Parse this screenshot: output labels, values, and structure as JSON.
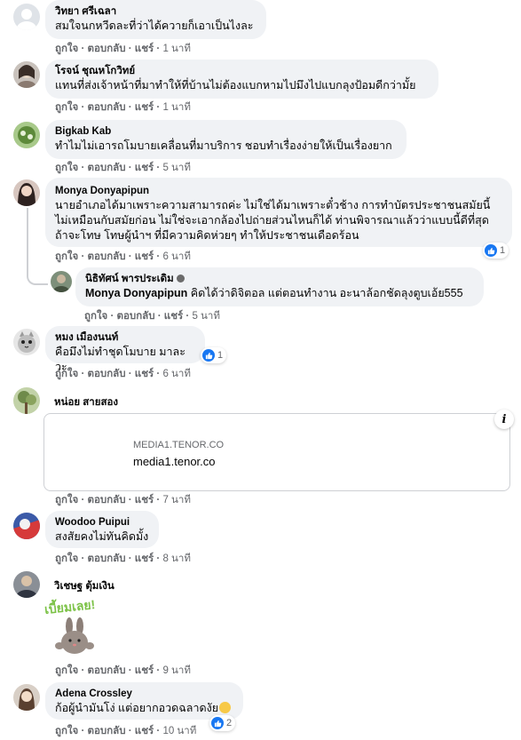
{
  "actions": {
    "like": "ถูกใจ",
    "reply": "ตอบกลับ",
    "share": "แชร์",
    "sep": "·"
  },
  "colors": {
    "bubble": "#f0f2f5",
    "meta": "#65676b",
    "like_blue": "#1877f2"
  },
  "comments": [
    {
      "name": "วิทยา ศรีเฉลา",
      "text": "สมใจนกหวีดละที่ว่าได้ควายก็เอาเป็นไงละ",
      "time": "1 นาที"
    },
    {
      "name": "โรจน์ ชุณหโกวิทย์",
      "text": "แทนที่ส่งเจ้าหน้าที่มาทำให้ที่บ้านไม่ต้องแบกหามไปมึงไปแบกลุงป้อมดีกว่ามั้ย",
      "time": "1 นาที"
    },
    {
      "name": "Bigkab Kab",
      "text": "ทำไมไม่เอารถโมบายเคลื่อนที่มาบริการ ชอบทำเรื่องง่ายให้เป็นเรื่องยาก",
      "time": "5 นาที"
    },
    {
      "name": "Monya Donyapipun",
      "text_lines": [
        "นายอำเภอได้มาเพราะความสามารถค่ะ ไม่ใช่ได้มาเพราะตั๋วช้าง การทำบัตรประชาชนสมัยนี้",
        "ไม่เหมือนกับสมัยก่อน ไม่ใช่จะเอากล้องไปถ่ายส่วนไหนก็ได้ ท่านพิจารณาแล้วว่าแบบนี้ดีที่สุด",
        "ถ้าจะโทษ โทษผู้นำฯ ที่มีความคิดห่วยๆ ทำให้ประชาชนเดือดร้อน"
      ],
      "time": "6 นาที",
      "reaction_count": "1"
    },
    {
      "name": "นิธิทัศน์ พารประเดิม",
      "mention": "Monya Donyapipun",
      "text": " คิดได้ว่าดิจิตอล แต่ตอนทำงาน อะนาล้อกชัดลุงตูบเอ้ย555",
      "time": "5 นาที"
    },
    {
      "name": "หมง เมืองนนท์",
      "text": "คือมึงไม่ทำชุดโมบาย มาละวะ",
      "time": "6 นาที",
      "reaction_count": "1"
    },
    {
      "name": "หน่อย สายสอง",
      "link_domain_caps": "MEDIA1.TENOR.CO",
      "link_domain": "media1.tenor.co",
      "info_icon": "i",
      "time": "7 นาที"
    },
    {
      "name": "Woodoo Puipui",
      "text": "สงสัยคงไม่ทันคิดมั้ง",
      "time": "8 นาที"
    },
    {
      "name": "วิเชษฐ ตุ้มเงิน",
      "sticker_text": "เบี้ยมเลย!",
      "time": "9 นาที"
    },
    {
      "name": "Adena Crossley",
      "text": "ก้อผู้นำมันโง่ แต่อยากอวดฉลาดงัย",
      "time": "10 นาที",
      "reaction_count": "2"
    }
  ]
}
